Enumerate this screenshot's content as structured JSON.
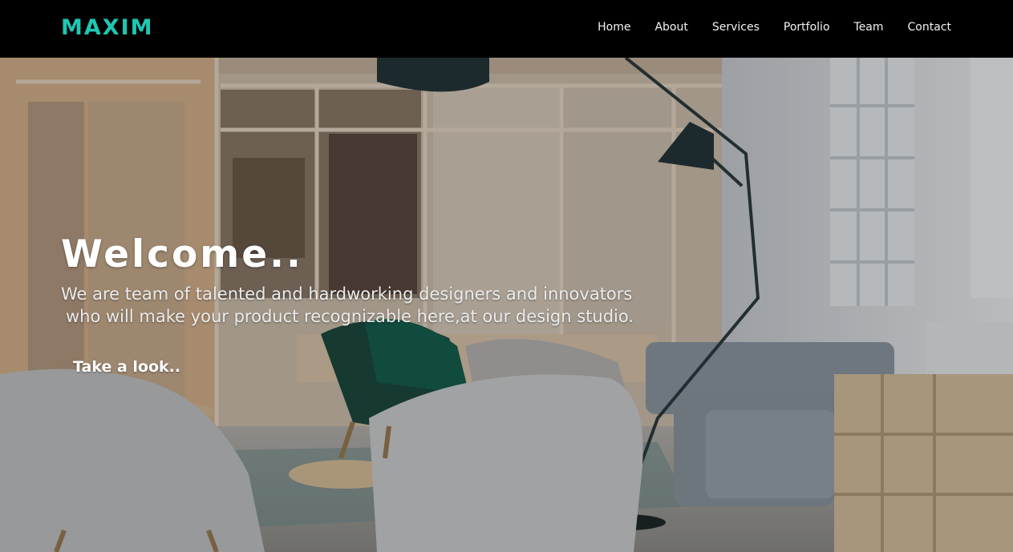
{
  "navbar": {
    "brand": "MAXIM",
    "links": [
      "Home",
      "About",
      "Services",
      "Portfolio",
      "Team",
      "Contact"
    ]
  },
  "hero": {
    "title": "Welcome..",
    "text_line1": "We are team of talented and hardworking designers and innovators",
    "text_line2": "who will make your product recognizable here,at our design studio.",
    "cta_label": "Take a look.."
  },
  "colors": {
    "brand_accent": "#1dc8b4",
    "navbar_bg": "#000000"
  }
}
